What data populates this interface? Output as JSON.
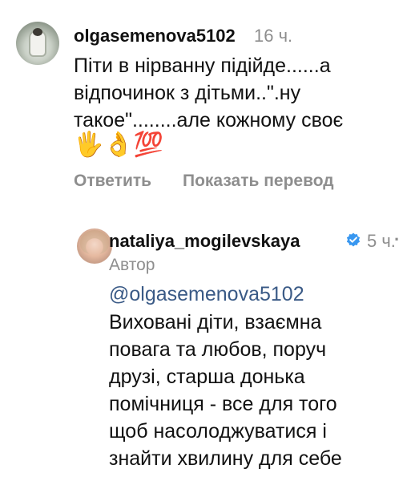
{
  "comment": {
    "username": "olgasemenova5102",
    "time": "16 ч.",
    "text_lines": [
      "Піти в нірванну підійде......а",
      "відпочинок з дітьми..\".ну",
      "такое\"........але кожному своє"
    ],
    "emoji_line": "🖐️👌💯",
    "reply_label": "Ответить",
    "translate_label": "Показать перевод"
  },
  "reply": {
    "username": "nataliya_mogilevskaya",
    "verified_icon": "verified-badge-icon",
    "time": "5 ч.",
    "more": "·",
    "author_label": "Автор",
    "mention": "@olgasemenova5102",
    "text_lines": [
      "Виховані діти, взаємна",
      "повага та любов, поруч",
      "друзі, старша донька",
      "помічниця - все для того",
      "щоб насолоджуватися і",
      "знайти хвилину для себе"
    ]
  },
  "colors": {
    "text": "#111111",
    "muted": "#8e8e8e",
    "mention": "#3a5a86",
    "verified": "#3897f0"
  }
}
